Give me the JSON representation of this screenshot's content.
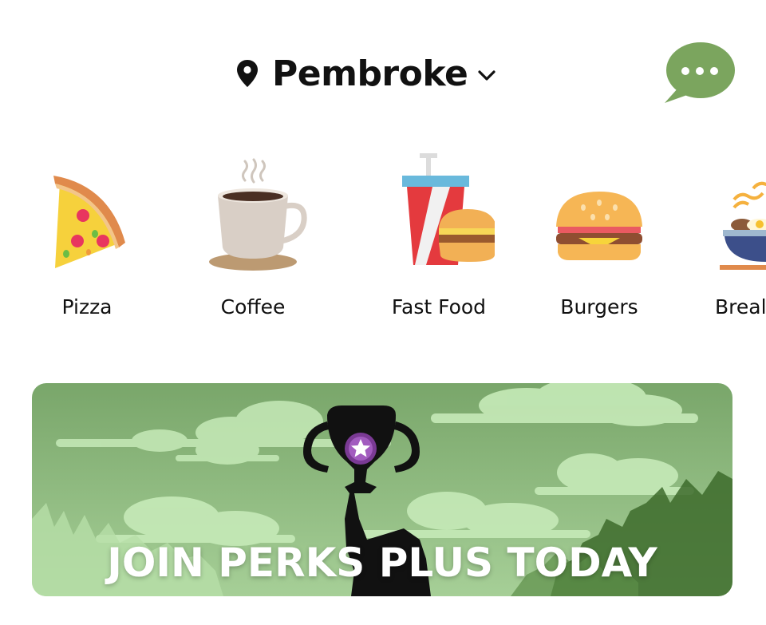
{
  "header": {
    "location_name": "Pembroke",
    "location_icon": "map-pin-icon",
    "dropdown_icon": "chevron-down-icon",
    "chat_icon": "chat-bubble-icon",
    "chat_color": "#7ba55e"
  },
  "categories": [
    {
      "label": "Pizza",
      "icon": "pizza-icon"
    },
    {
      "label": "Coffee",
      "icon": "coffee-icon"
    },
    {
      "label": "Fast Food",
      "icon": "fast-food-icon"
    },
    {
      "label": "Burgers",
      "icon": "burger-icon"
    },
    {
      "label": "Breal",
      "icon": "breakfast-icon"
    }
  ],
  "banner": {
    "title": "JOIN PERKS PLUS TODAY",
    "icon": "trophy-icon",
    "background_color": "#8fbf7e"
  }
}
